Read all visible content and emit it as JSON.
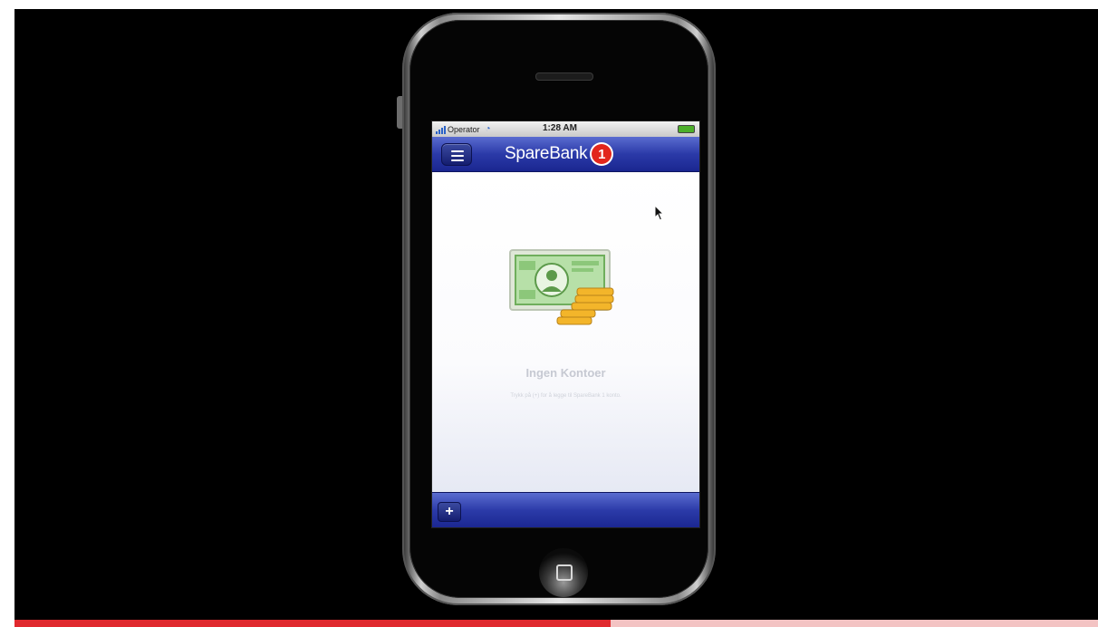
{
  "statusbar": {
    "carrier": "Operator",
    "time": "1:28 AM",
    "signal_icon": "signal-bars-icon",
    "wifi_icon": "wifi-icon",
    "battery_icon": "battery-icon"
  },
  "navbar": {
    "brand": "SpareBank",
    "brand_logo_text": "1",
    "menu_icon": "menu-icon"
  },
  "empty_state": {
    "icon": "money-icon",
    "title": "Ingen Kontoer",
    "hint": "Trykk på (+) for å legge til SpareBank 1 konto."
  },
  "toolbar": {
    "add_label": "+"
  },
  "video": {
    "progress": 0.55
  },
  "colors": {
    "nav_blue": "#2b3aa8",
    "brand_red": "#e2261c",
    "progress_red": "#e0292e"
  }
}
